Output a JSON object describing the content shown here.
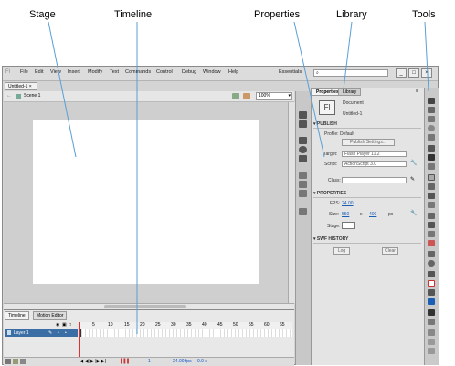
{
  "callouts": {
    "stage": "Stage",
    "timeline": "Timeline",
    "properties": "Properties",
    "library": "Library",
    "tools": "Tools"
  },
  "app": {
    "logo": "Fl",
    "menu": [
      "File",
      "Edit",
      "View",
      "Insert",
      "Modify",
      "Text",
      "Commands",
      "Control",
      "Debug",
      "Window",
      "Help"
    ],
    "workspace": "Essentials",
    "search_placeholder": "",
    "window_buttons": [
      "_",
      "□",
      "×"
    ],
    "doc_tab": "Untitled-1 ×",
    "scene": "Scene 1",
    "zoom": "100%"
  },
  "timeline": {
    "tabs": [
      "Timeline",
      "Motion Editor"
    ],
    "layer": "Layer 1",
    "frame_numbers": [
      "5",
      "10",
      "15",
      "20",
      "25",
      "30",
      "35",
      "40",
      "45",
      "50",
      "55",
      "60",
      "65"
    ],
    "status": [
      "1",
      "24.00 fps",
      "0.0 s"
    ]
  },
  "properties": {
    "tabs": [
      "Properties",
      "Library"
    ],
    "doc_icon": "Fl",
    "doc_type": "Document",
    "doc_name": "Untitled-1",
    "publish": {
      "header": "PUBLISH",
      "profile": "Profile: Default",
      "settings_button": "Publish Settings...",
      "target_label": "Target:",
      "target_value": "Flash Player 11.2",
      "script_label": "Script:",
      "script_value": "ActionScript 3.0",
      "class_label": "Class:"
    },
    "props": {
      "header": "PROPERTIES",
      "fps_label": "FPS:",
      "fps_value": "24.00",
      "size_label": "Size:",
      "width": "550",
      "x": "x",
      "height": "400",
      "unit": "px",
      "stage_label": "Stage:"
    },
    "history": {
      "header": "SWF HISTORY",
      "log_button": "Log",
      "clear_button": "Clear"
    }
  },
  "colors": {
    "accent_blue": "#1a5fb4",
    "callout_line": "#5a9fd4",
    "playhead": "#e03030",
    "stage": "#ffffff"
  }
}
